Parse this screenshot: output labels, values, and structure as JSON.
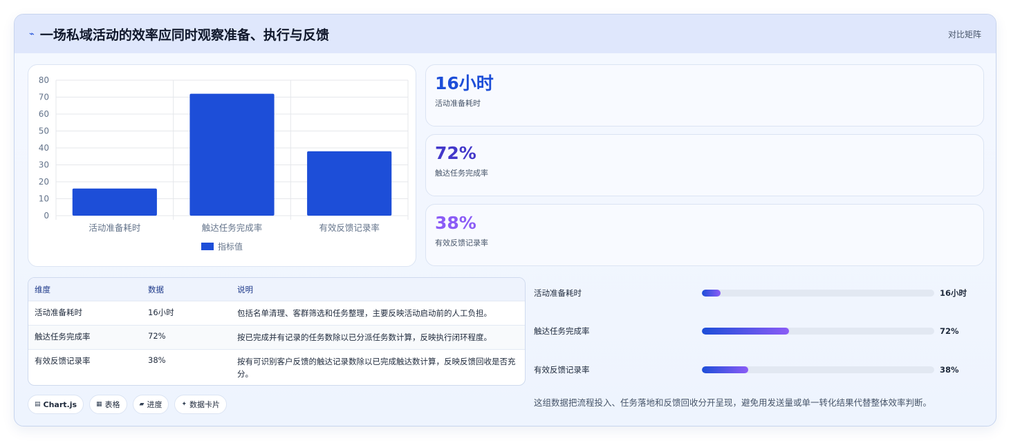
{
  "header": {
    "icon": "pulse-icon",
    "title": "一场私域活动的效率应同时观察准备、执行与反馈",
    "right_label": "对比矩阵"
  },
  "chart_data": {
    "type": "bar",
    "categories": [
      "活动准备耗时",
      "触达任务完成率",
      "有效反馈记录率"
    ],
    "series": [
      {
        "name": "指标值",
        "values": [
          16,
          72,
          38
        ],
        "color": "#1d4ed8"
      }
    ],
    "ylim": [
      0,
      80
    ],
    "yticks": [
      0,
      10,
      20,
      30,
      40,
      50,
      60,
      70,
      80
    ],
    "grid": true,
    "legend": "bottom"
  },
  "kpis": [
    {
      "value": "16小时",
      "label": "活动准备耗时",
      "color": "#1d4ed8"
    },
    {
      "value": "72%",
      "label": "触达任务完成率",
      "color": "#4338ca"
    },
    {
      "value": "38%",
      "label": "有效反馈记录率",
      "color": "#8b5cf6"
    }
  ],
  "table": {
    "headers": [
      "维度",
      "数据",
      "说明"
    ],
    "rows": [
      [
        "活动准备耗时",
        "16小时",
        "包括名单清理、客群筛选和任务整理，主要反映活动启动前的人工负担。"
      ],
      [
        "触达任务完成率",
        "72%",
        "按已完成并有记录的任务数除以已分派任务数计算，反映执行闭环程度。"
      ],
      [
        "有效反馈记录率",
        "38%",
        "按有可识别客户反馈的触达记录数除以已完成触达数计算，反映反馈回收是否充分。"
      ]
    ]
  },
  "tags": [
    {
      "icon": "chart-icon",
      "glyph": "▤",
      "label": "Chart.js"
    },
    {
      "icon": "table-icon",
      "glyph": "▦",
      "label": "表格"
    },
    {
      "icon": "progress-icon",
      "glyph": "▰",
      "label": "进度"
    },
    {
      "icon": "sparkle-icon",
      "glyph": "✦",
      "label": "数据卡片"
    }
  ],
  "progress": [
    {
      "label": "活动准备耗时",
      "value": "16小时",
      "fraction": 0.08
    },
    {
      "label": "触达任务完成率",
      "value": "72%",
      "fraction": 0.375
    },
    {
      "label": "有效反馈记录率",
      "value": "38%",
      "fraction": 0.2
    }
  ],
  "note": "这组数据把流程投入、任务落地和反馈回收分开呈现，避免用发送量或单一转化结果代替整体效率判断。"
}
